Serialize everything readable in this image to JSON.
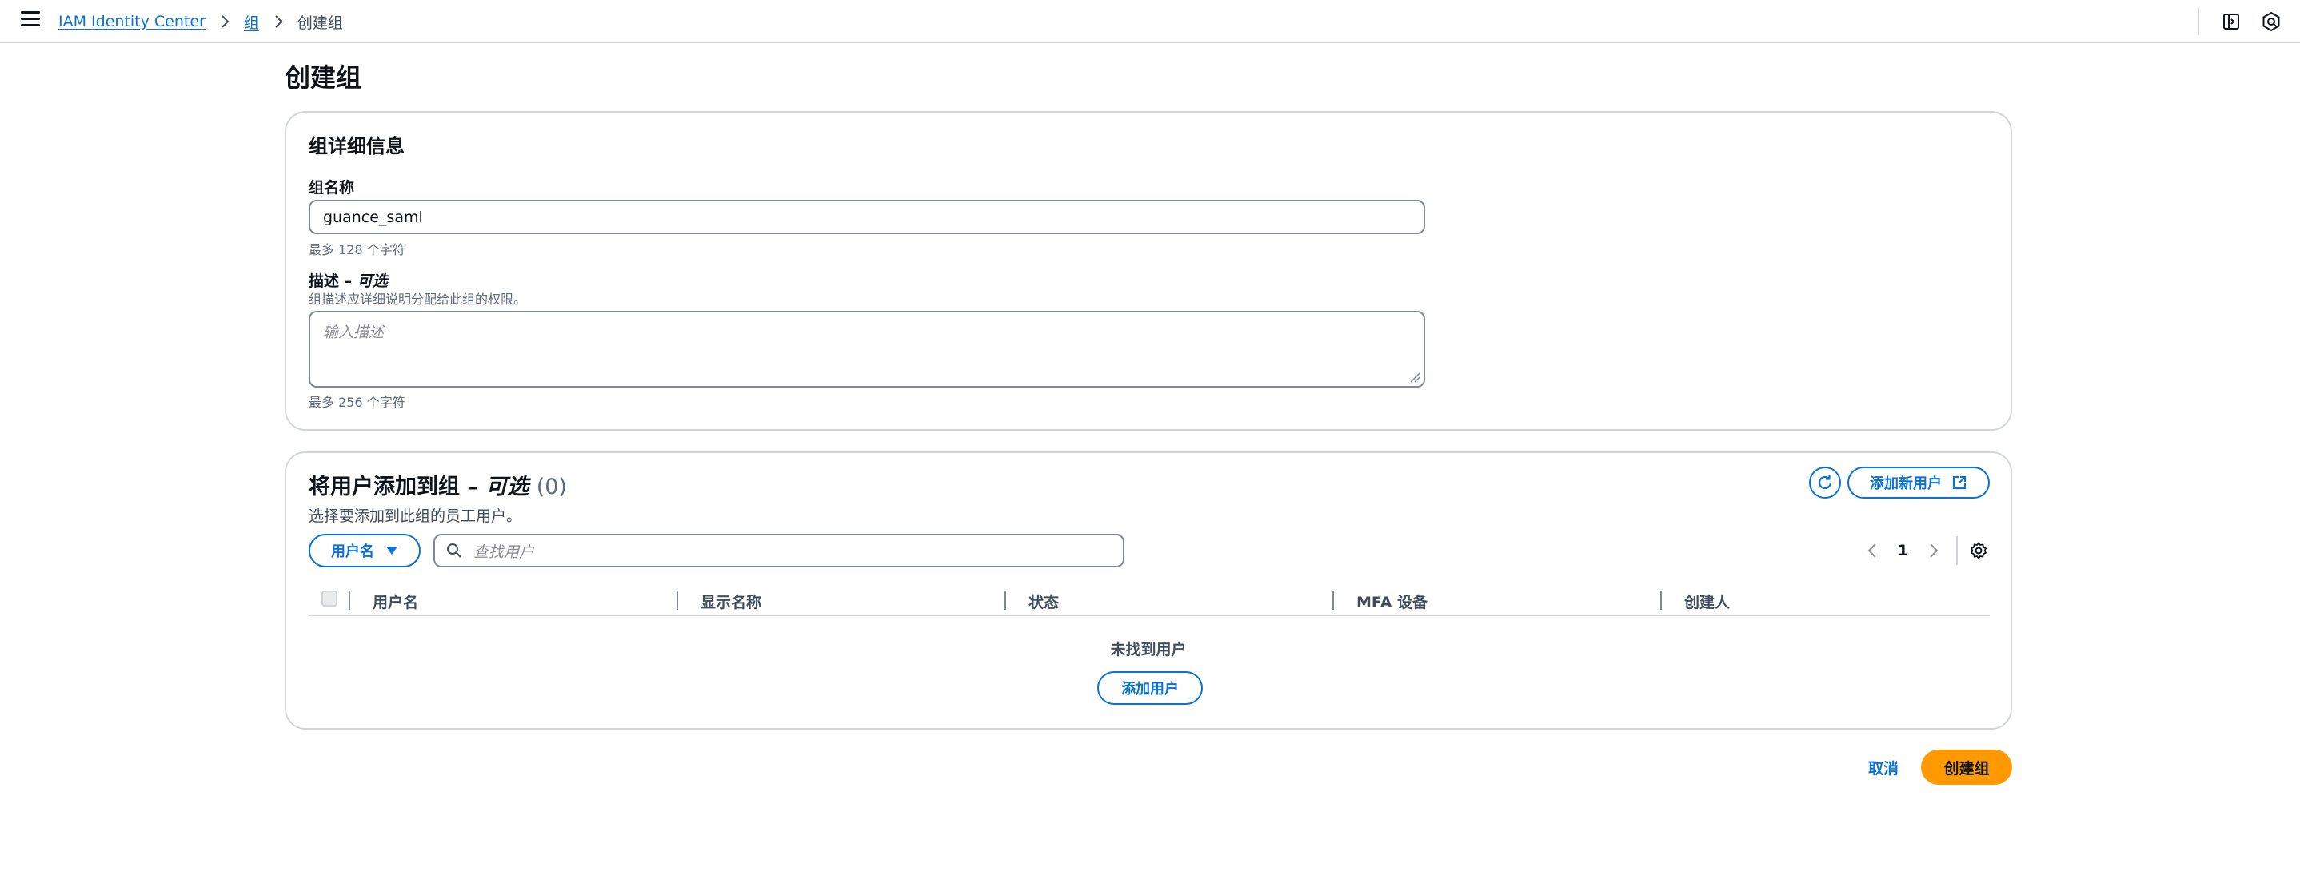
{
  "breadcrumb": {
    "items": [
      "IAM Identity Center",
      "组"
    ],
    "current": "创建组"
  },
  "page": {
    "title": "创建组"
  },
  "details": {
    "heading": "组详细信息",
    "name_label": "组名称",
    "name_value": "guance_saml",
    "name_hint": "最多 128 个字符",
    "desc_label": "描述 – ",
    "desc_optional": "可选",
    "desc_help": "组描述应详细说明分配给此组的权限。",
    "desc_placeholder": "输入描述",
    "desc_hint": "最多 256 个字符"
  },
  "users": {
    "heading": "将用户添加到组 – ",
    "heading_optional": "可选",
    "count": "(0)",
    "description": "选择要添加到此组的员工用户。",
    "add_new_user": "添加新用户",
    "filter_property": "用户名",
    "search_placeholder": "查找用户",
    "page": "1",
    "columns": [
      "用户名",
      "显示名称",
      "状态",
      "MFA 设备",
      "创建人"
    ],
    "empty_text": "未找到用户",
    "add_user": "添加用户"
  },
  "footer": {
    "cancel": "取消",
    "create": "创建组"
  },
  "colors": {
    "link": "#0972d3",
    "primary": "#ff9900",
    "border": "#d1d5db"
  }
}
